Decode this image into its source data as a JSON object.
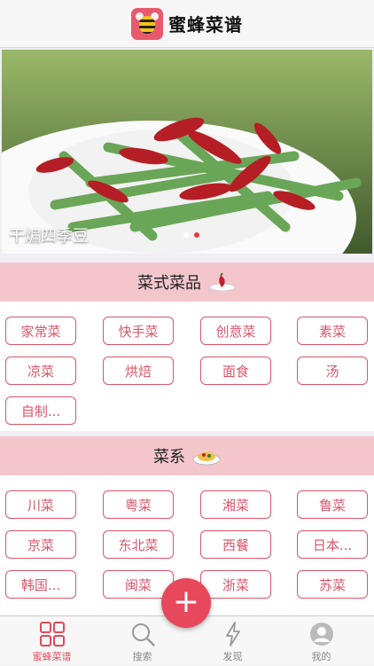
{
  "header": {
    "title": "蜜蜂菜谱"
  },
  "banner": {
    "caption": "干煸四季豆",
    "dots": 2,
    "active_dot": 1
  },
  "sections": [
    {
      "title": "菜式菜品",
      "icon": "chili-pepper-icon",
      "items": [
        "家常菜",
        "快手菜",
        "创意菜",
        "素菜",
        "凉菜",
        "烘焙",
        "面食",
        "汤",
        "自制..."
      ]
    },
    {
      "title": "菜系",
      "icon": "noodle-plate-icon",
      "items": [
        "川菜",
        "粤菜",
        "湘菜",
        "鲁菜",
        "京菜",
        "东北菜",
        "西餐",
        "日本...",
        "韩国...",
        "闽菜",
        "浙菜",
        "苏菜"
      ]
    }
  ],
  "tabbar": {
    "items": [
      {
        "label": "蜜蜂菜谱",
        "icon": "grid-icon",
        "active": true
      },
      {
        "label": "搜索",
        "icon": "search-icon",
        "active": false
      },
      {
        "label": "发现",
        "icon": "lightning-icon",
        "active": false
      },
      {
        "label": "我的",
        "icon": "user-icon",
        "active": false
      }
    ]
  },
  "fab": {
    "label": "+"
  },
  "colors": {
    "accent": "#e8485c",
    "section_bg": "#f3c6cc",
    "tag_border": "#d9576a"
  }
}
